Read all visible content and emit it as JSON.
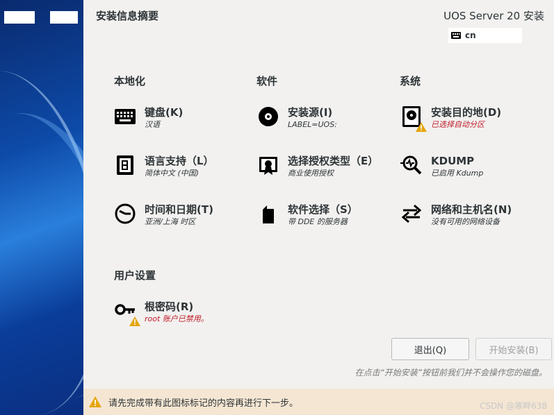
{
  "header": {
    "title": "安装信息摘要",
    "product": "UOS Server 20 安装",
    "keyboard_layout": "cn"
  },
  "sections": {
    "localization": {
      "title": "本地化",
      "keyboard": {
        "name": "键盘(K)",
        "status": "汉语"
      },
      "language": {
        "name": "语言支持（L）",
        "status": "简体中文 (中国)"
      },
      "time": {
        "name": "时间和日期(T)",
        "status": "亚洲/上海 时区"
      }
    },
    "software": {
      "title": "软件",
      "source": {
        "name": "安装源(I)",
        "status": "LABEL=UOS:"
      },
      "license": {
        "name": "选择授权类型（E）",
        "status": "商业使用授权"
      },
      "selection": {
        "name": "软件选择（S）",
        "status": "带 DDE 的服务器"
      }
    },
    "system": {
      "title": "系统",
      "destination": {
        "name": "安装目的地(D)",
        "status": "已选择自动分区"
      },
      "kdump": {
        "name": "KDUMP",
        "status": "已启用 Kdump"
      },
      "network": {
        "name": "网络和主机名(N)",
        "status": "没有可用的网络设备"
      }
    },
    "user": {
      "title": "用户设置",
      "root": {
        "name": "根密码(R)",
        "status": "root 账户已禁用。"
      }
    }
  },
  "buttons": {
    "quit": "退出(Q)",
    "begin": "开始安装(B)"
  },
  "hint": "在点击“开始安装”按钮前我们并不会操作您的磁盘。",
  "warning_bar": "请先完成带有此图标标记的内容再进行下一步。",
  "watermark": "CSDN @寒畔638",
  "colors": {
    "warning": "#e5a50a",
    "error_text": "#c01c28",
    "warning_bar_bg": "#f5e6d3"
  }
}
